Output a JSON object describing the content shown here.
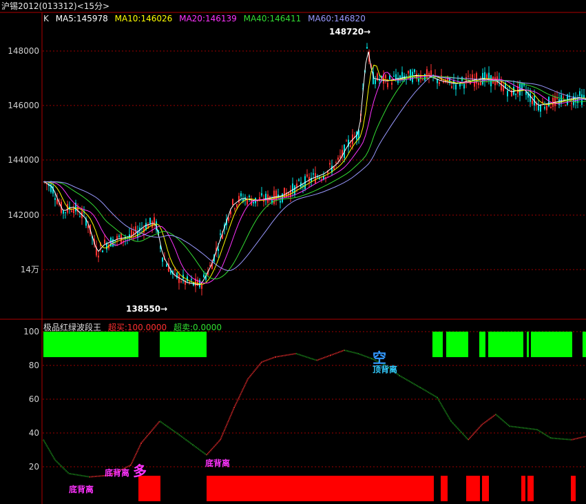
{
  "window": {
    "title": "沪锡2012(013312)<15分>"
  },
  "kline": {
    "label": "K",
    "ma": [
      {
        "name": "MA5:145978",
        "color": "#ffffff"
      },
      {
        "name": "MA10:146026",
        "color": "#ffff00"
      },
      {
        "name": "MA20:146139",
        "color": "#ff33ff"
      },
      {
        "name": "MA40:146411",
        "color": "#33dd33"
      },
      {
        "name": "MA60:146820",
        "color": "#9999ff"
      }
    ],
    "y_ticks": [
      "148000",
      "146000",
      "144000",
      "142000",
      "14万"
    ],
    "high_label": "148720→",
    "low_label": "138550→"
  },
  "indicator": {
    "name": "极品红绿波段王",
    "overbought": "超买:100.0000",
    "oversold": "超卖:0.0000",
    "y_ticks": [
      "100",
      "80",
      "60",
      "40",
      "20"
    ],
    "annotations": [
      "底背离",
      "底背离",
      "底背离",
      "顶背离",
      "多",
      "空"
    ]
  },
  "colors": {
    "up": "#ff3232",
    "down": "#00e0e0",
    "grid": "#a00000",
    "green_band": "#00ff00",
    "red_band": "#ff0000",
    "border": "#b00000"
  }
}
